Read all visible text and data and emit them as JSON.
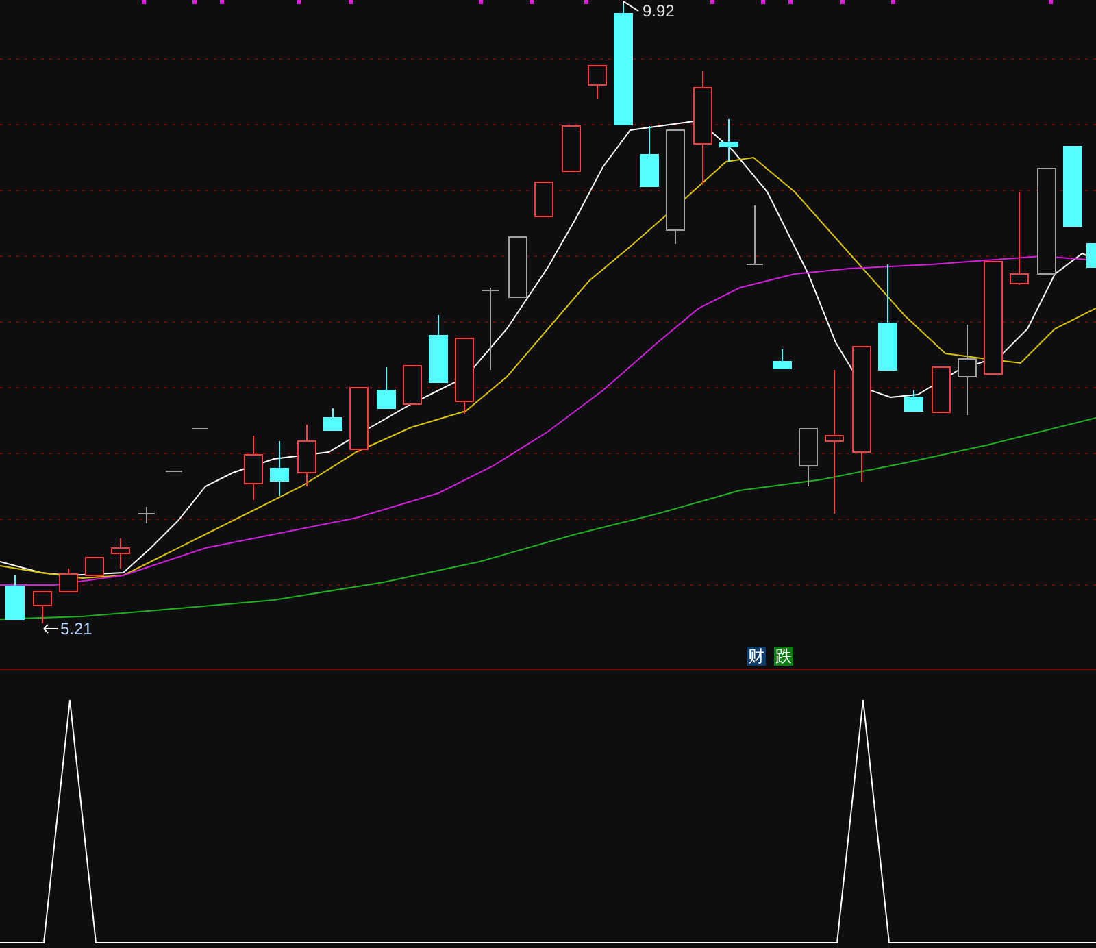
{
  "price_chart": {
    "high_label": "9.92",
    "low_label": "5.21"
  },
  "signal_badges": [
    {
      "label": "财",
      "color": "#0d3a66"
    },
    {
      "label": "跌",
      "color": "#0b7d12"
    }
  ]
}
